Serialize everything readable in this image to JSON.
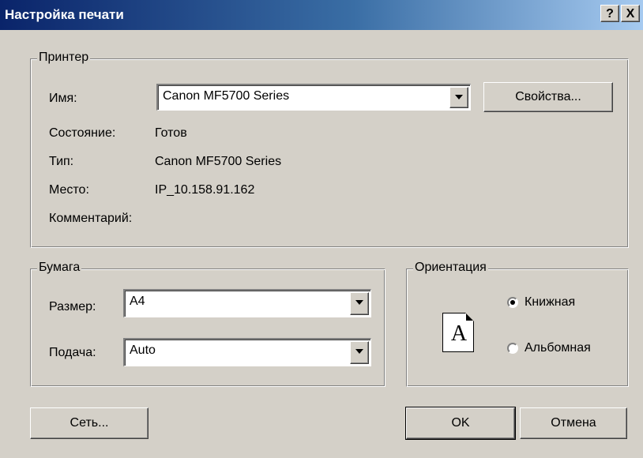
{
  "window": {
    "title": "Настройка печати",
    "help_label": "?",
    "close_label": "X"
  },
  "printer": {
    "legend": "Принтер",
    "name_label": "Имя:",
    "name_value": "Canon MF5700 Series",
    "properties_label": "Свойства...",
    "status_label": "Состояние:",
    "status_value": "Готов",
    "type_label": "Тип:",
    "type_value": "Canon MF5700 Series",
    "location_label": "Место:",
    "location_value": "IP_10.158.91.162",
    "comment_label": "Комментарий:",
    "comment_value": ""
  },
  "paper": {
    "legend": "Бумага",
    "size_label": "Размер:",
    "size_value": "A4",
    "source_label": "Подача:",
    "source_value": "Auto"
  },
  "orientation": {
    "legend": "Ориентация",
    "page_letter": "A",
    "portrait_label": "Книжная",
    "landscape_label": "Альбомная",
    "selected": "portrait"
  },
  "buttons": {
    "network_label": "Сеть...",
    "ok_label": "OK",
    "cancel_label": "Отмена"
  }
}
